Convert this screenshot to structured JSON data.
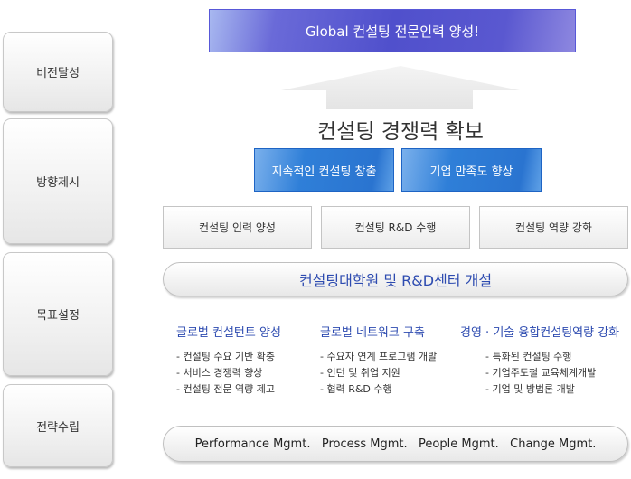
{
  "stages": [
    "비전달성",
    "방향제시",
    "목표설정",
    "전략수립"
  ],
  "vision": "Global 컨설팅 전문인력 양성!",
  "competitiveness": "컨설팅 경쟁력 확보",
  "directions": [
    "지속적인 컨설팅 창출",
    "기업 만족도 향상"
  ],
  "goals": [
    "컨설팅 인력 양성",
    "컨설팅 R&D 수행",
    "컨설팅 역량 강화"
  ],
  "goal_bar": "컨설팅대학원 및 R&D센터 개설",
  "strategies": [
    {
      "title": "글로벌 컨설턴트 양성",
      "items": [
        "컨설팅 수요 기반 확충",
        "서비스 경쟁력 향상",
        "컨설팅 전문 역량 제고"
      ]
    },
    {
      "title": "글로벌 네트워크 구축",
      "items": [
        "수요자 연계 프로그램 개발",
        "인턴 및 취업 지원",
        "협력 R&D 수행"
      ]
    },
    {
      "title": "경영 · 기술 융합컨설팅역량 강화",
      "items": [
        "특화된 컨설팅 수행",
        "기업주도철 교육체계개발",
        "기업 및 방법론 개발"
      ]
    }
  ],
  "management": "Performance Mgmt.   Process Mgmt.   People Mgmt.   Change Mgmt."
}
